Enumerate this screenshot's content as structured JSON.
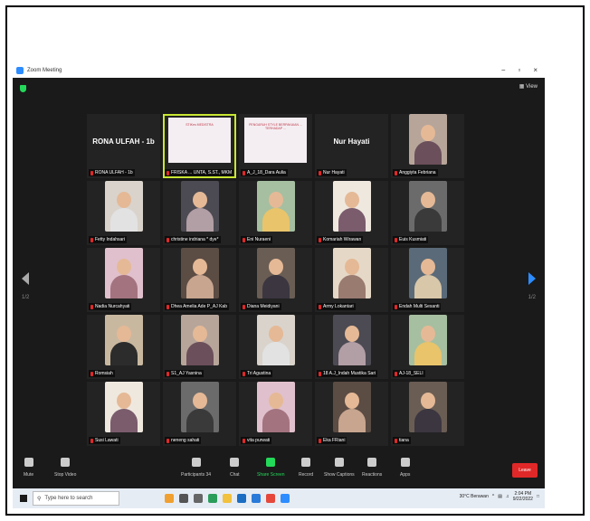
{
  "window": {
    "title": "Zoom Meeting",
    "minimize": "−",
    "maximize": "▫",
    "close": "×"
  },
  "meeting": {
    "view_label": "View",
    "page_left": "1/2",
    "page_right": "1/2",
    "participants": [
      {
        "name": "RONA ULFAH - 1b",
        "display_name": "RONA ULFAH - 1b",
        "video": false
      },
      {
        "name": "FRISKA ... UNTA, S.ST., MKM",
        "video": true,
        "active": true,
        "slide": "STIKes MEDISTRA"
      },
      {
        "name": "A_J_18_Dara Aulia",
        "video": true,
        "slide": "PENGARUH STYLE BERPAKAIAN ... TERHADAP ..."
      },
      {
        "name": "Nur Hayati",
        "display_name": "Nur Hayati",
        "video": false
      },
      {
        "name": "Anggiyta Febriana",
        "video": true
      },
      {
        "name": "Fetty Indahsari",
        "video": true
      },
      {
        "name": "christine indriana * dye*",
        "video": true
      },
      {
        "name": "Eni Nuraeni",
        "video": true
      },
      {
        "name": "Komariah Wirawan",
        "video": true
      },
      {
        "name": "Euis Kusmiati",
        "video": true
      },
      {
        "name": "Nadia Nurcahyati",
        "video": true,
        "share_badge": false
      },
      {
        "name": "Dhea Amelia Ade P_AJ Kab",
        "video": true
      },
      {
        "name": "Diana Meidiyani",
        "video": true
      },
      {
        "name": "Army Lokantari",
        "video": true
      },
      {
        "name": "Endah Multi Sesanti",
        "video": true
      },
      {
        "name": "Romsiah",
        "video": true
      },
      {
        "name": "S1_AJ Yasnina",
        "video": true
      },
      {
        "name": "Tri Agustina",
        "video": true
      },
      {
        "name": "18 A.J_Indah Mustika Sari",
        "video": true
      },
      {
        "name": "AJ-18_SELI",
        "video": true
      },
      {
        "name": "Susi Lawati",
        "video": true
      },
      {
        "name": "neneng sahati",
        "video": true
      },
      {
        "name": "vita purwati",
        "video": true
      },
      {
        "name": "Eka FRiani",
        "video": true
      },
      {
        "name": "tiana",
        "video": true
      }
    ]
  },
  "toolbar": {
    "mute": "Mute",
    "stop_video": "Stop Video",
    "participants": "Participants",
    "participants_count": "34",
    "chat": "Chat",
    "share_screen": "Share Screen",
    "record": "Record",
    "show_captions": "Show Captions",
    "reactions": "Reactions",
    "apps": "Apps",
    "leave": "Leave"
  },
  "taskbar": {
    "search_placeholder": "Type here to search",
    "weather": "30°C  Berawan",
    "time": "2:04 PM",
    "date": "9/22/2022"
  },
  "colors": {
    "accent": "#2d8cff",
    "leave": "#e02828",
    "share": "#23d959",
    "active_speaker": "#c8e632"
  }
}
